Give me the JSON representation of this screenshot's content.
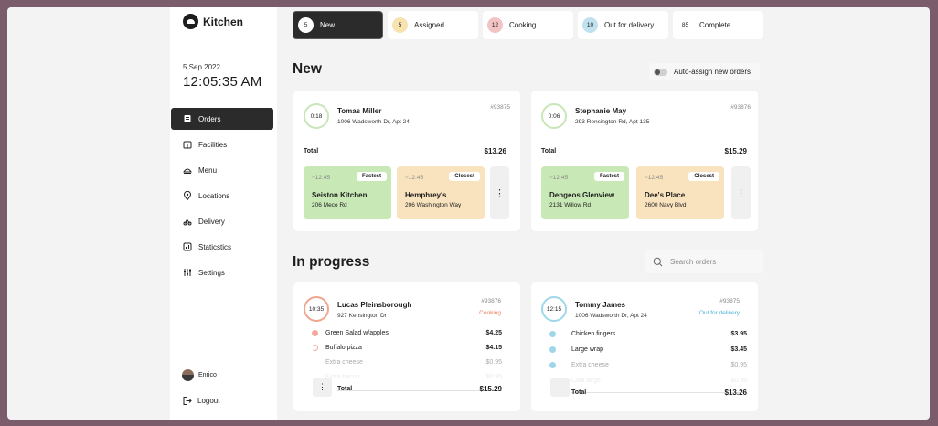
{
  "app": {
    "name": "Kitchen"
  },
  "clock": {
    "date": "5 Sep 2022",
    "time": "12:05:35 AM"
  },
  "sidebar": {
    "items": [
      {
        "label": "Orders",
        "icon": "orders-icon",
        "active": true
      },
      {
        "label": "Facilities",
        "icon": "facilities-icon"
      },
      {
        "label": "Menu",
        "icon": "menu-icon"
      },
      {
        "label": "Locations",
        "icon": "location-pin-icon"
      },
      {
        "label": "Delivery",
        "icon": "delivery-icon"
      },
      {
        "label": "Staticstics",
        "icon": "statistics-icon"
      },
      {
        "label": "Settings",
        "icon": "settings-sliders-icon"
      }
    ],
    "user": {
      "name": "Enrico"
    },
    "logout": "Logout"
  },
  "tabs": [
    {
      "count": "5",
      "label": "New",
      "active": true
    },
    {
      "count": "5",
      "label": "Assigned",
      "color": "#f6e3b0"
    },
    {
      "count": "12",
      "label": "Cooking",
      "color": "#f2c4c4"
    },
    {
      "count": "10",
      "label": "Out for delivery",
      "color": "#bfe2ee"
    },
    {
      "count": "85",
      "label": "Complete",
      "color": "#ffffff"
    }
  ],
  "new_section": {
    "title": "New",
    "auto_assign": "Auto-assign new orders",
    "orders": [
      {
        "timer": "0:18",
        "name": "Tomas Miller",
        "address": "1006 Wadsworth Dr, Apt 24",
        "id": "#93875",
        "total_label": "Total",
        "total": "$13.26",
        "facilities": [
          {
            "time": "~12:45",
            "tag": "Fastest",
            "name": "Seiston Kitchen",
            "street": "206 Meco Rd"
          },
          {
            "time": "~12:45",
            "tag": "Closest",
            "name": "Hemphrey's",
            "street": "206 Washington Way"
          }
        ]
      },
      {
        "timer": "0:06",
        "name": "Stephanie May",
        "address": "293 Rensington Rd, Apt 135",
        "id": "#93876",
        "total_label": "Total",
        "total": "$15.29",
        "facilities": [
          {
            "time": "~12:45",
            "tag": "Fastest",
            "name": "Dengeos Glenview",
            "street": "2131 Willow Rd"
          },
          {
            "time": "~12:45",
            "tag": "Closest",
            "name": "Dee's Place",
            "street": "2600 Navy Blvd"
          }
        ]
      }
    ]
  },
  "progress_section": {
    "title": "In progress",
    "search_placeholder": "Search orders",
    "orders": [
      {
        "timer": "10:35",
        "name": "Lucas Pleinsborough",
        "address": "927 Kensington Dr",
        "id": "#93876",
        "status": "Cooking",
        "status_color": "#e57b5b",
        "items": [
          {
            "name": "Green Salad w/apples",
            "price": "$4.25"
          },
          {
            "name": "Buffalo pizza",
            "price": "$4.15"
          },
          {
            "name": "Extra cheese",
            "price": "$0.95"
          },
          {
            "name": "Extra bacon",
            "price": "$0.95"
          }
        ],
        "total_label": "Total",
        "total": "$15.29"
      },
      {
        "timer": "12:15",
        "name": "Tommy James",
        "address": "1006 Wadsworth Dr, Apt 24",
        "id": "#93875",
        "status": "Out for delivery",
        "status_color": "#4fb3d6",
        "items": [
          {
            "name": "Chicken fingers",
            "price": "$3.95"
          },
          {
            "name": "Large wrap",
            "price": "$3.45"
          },
          {
            "name": "Extra cheese",
            "price": "$0.95"
          },
          {
            "name": "Cola large",
            "price": "$0.95"
          }
        ],
        "total_label": "Total",
        "total": "$13.26"
      }
    ]
  }
}
